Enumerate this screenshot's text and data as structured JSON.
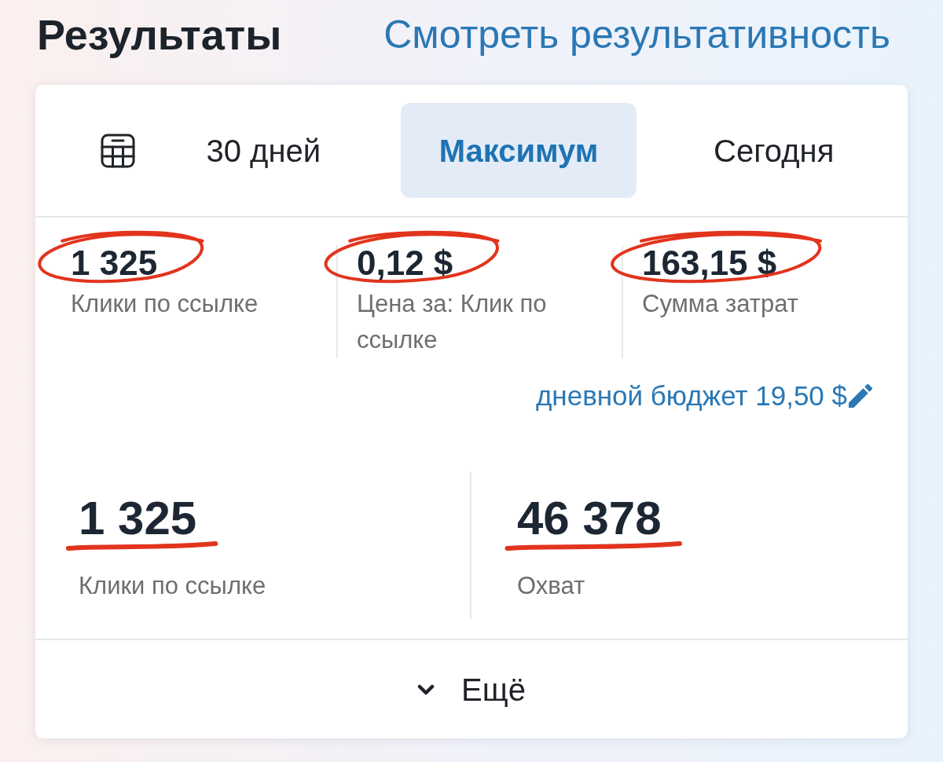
{
  "header": {
    "title": "Результаты",
    "link": "Смотреть результативность"
  },
  "period_tabs": [
    {
      "label": "30 дней",
      "selected": false
    },
    {
      "label": "Максимум",
      "selected": true
    },
    {
      "label": "Сегодня",
      "selected": false
    }
  ],
  "summary_metrics": [
    {
      "value": "1 325",
      "label": "Клики по ссылке",
      "circled": true
    },
    {
      "value": "0,12 $",
      "label": "Цена за: Клик по ссылке",
      "circled": true
    },
    {
      "value": "163,15 $",
      "label": "Сумма затрат",
      "circled": true
    }
  ],
  "daily_budget": {
    "label": "дневной бюджет 19,50 $"
  },
  "main_metrics": [
    {
      "value": "1 325",
      "label": "Клики по ссылке",
      "underlined": true
    },
    {
      "value": "46 378",
      "label": "Охват",
      "underlined": true
    }
  ],
  "more_button": {
    "label": "Ещё"
  }
}
